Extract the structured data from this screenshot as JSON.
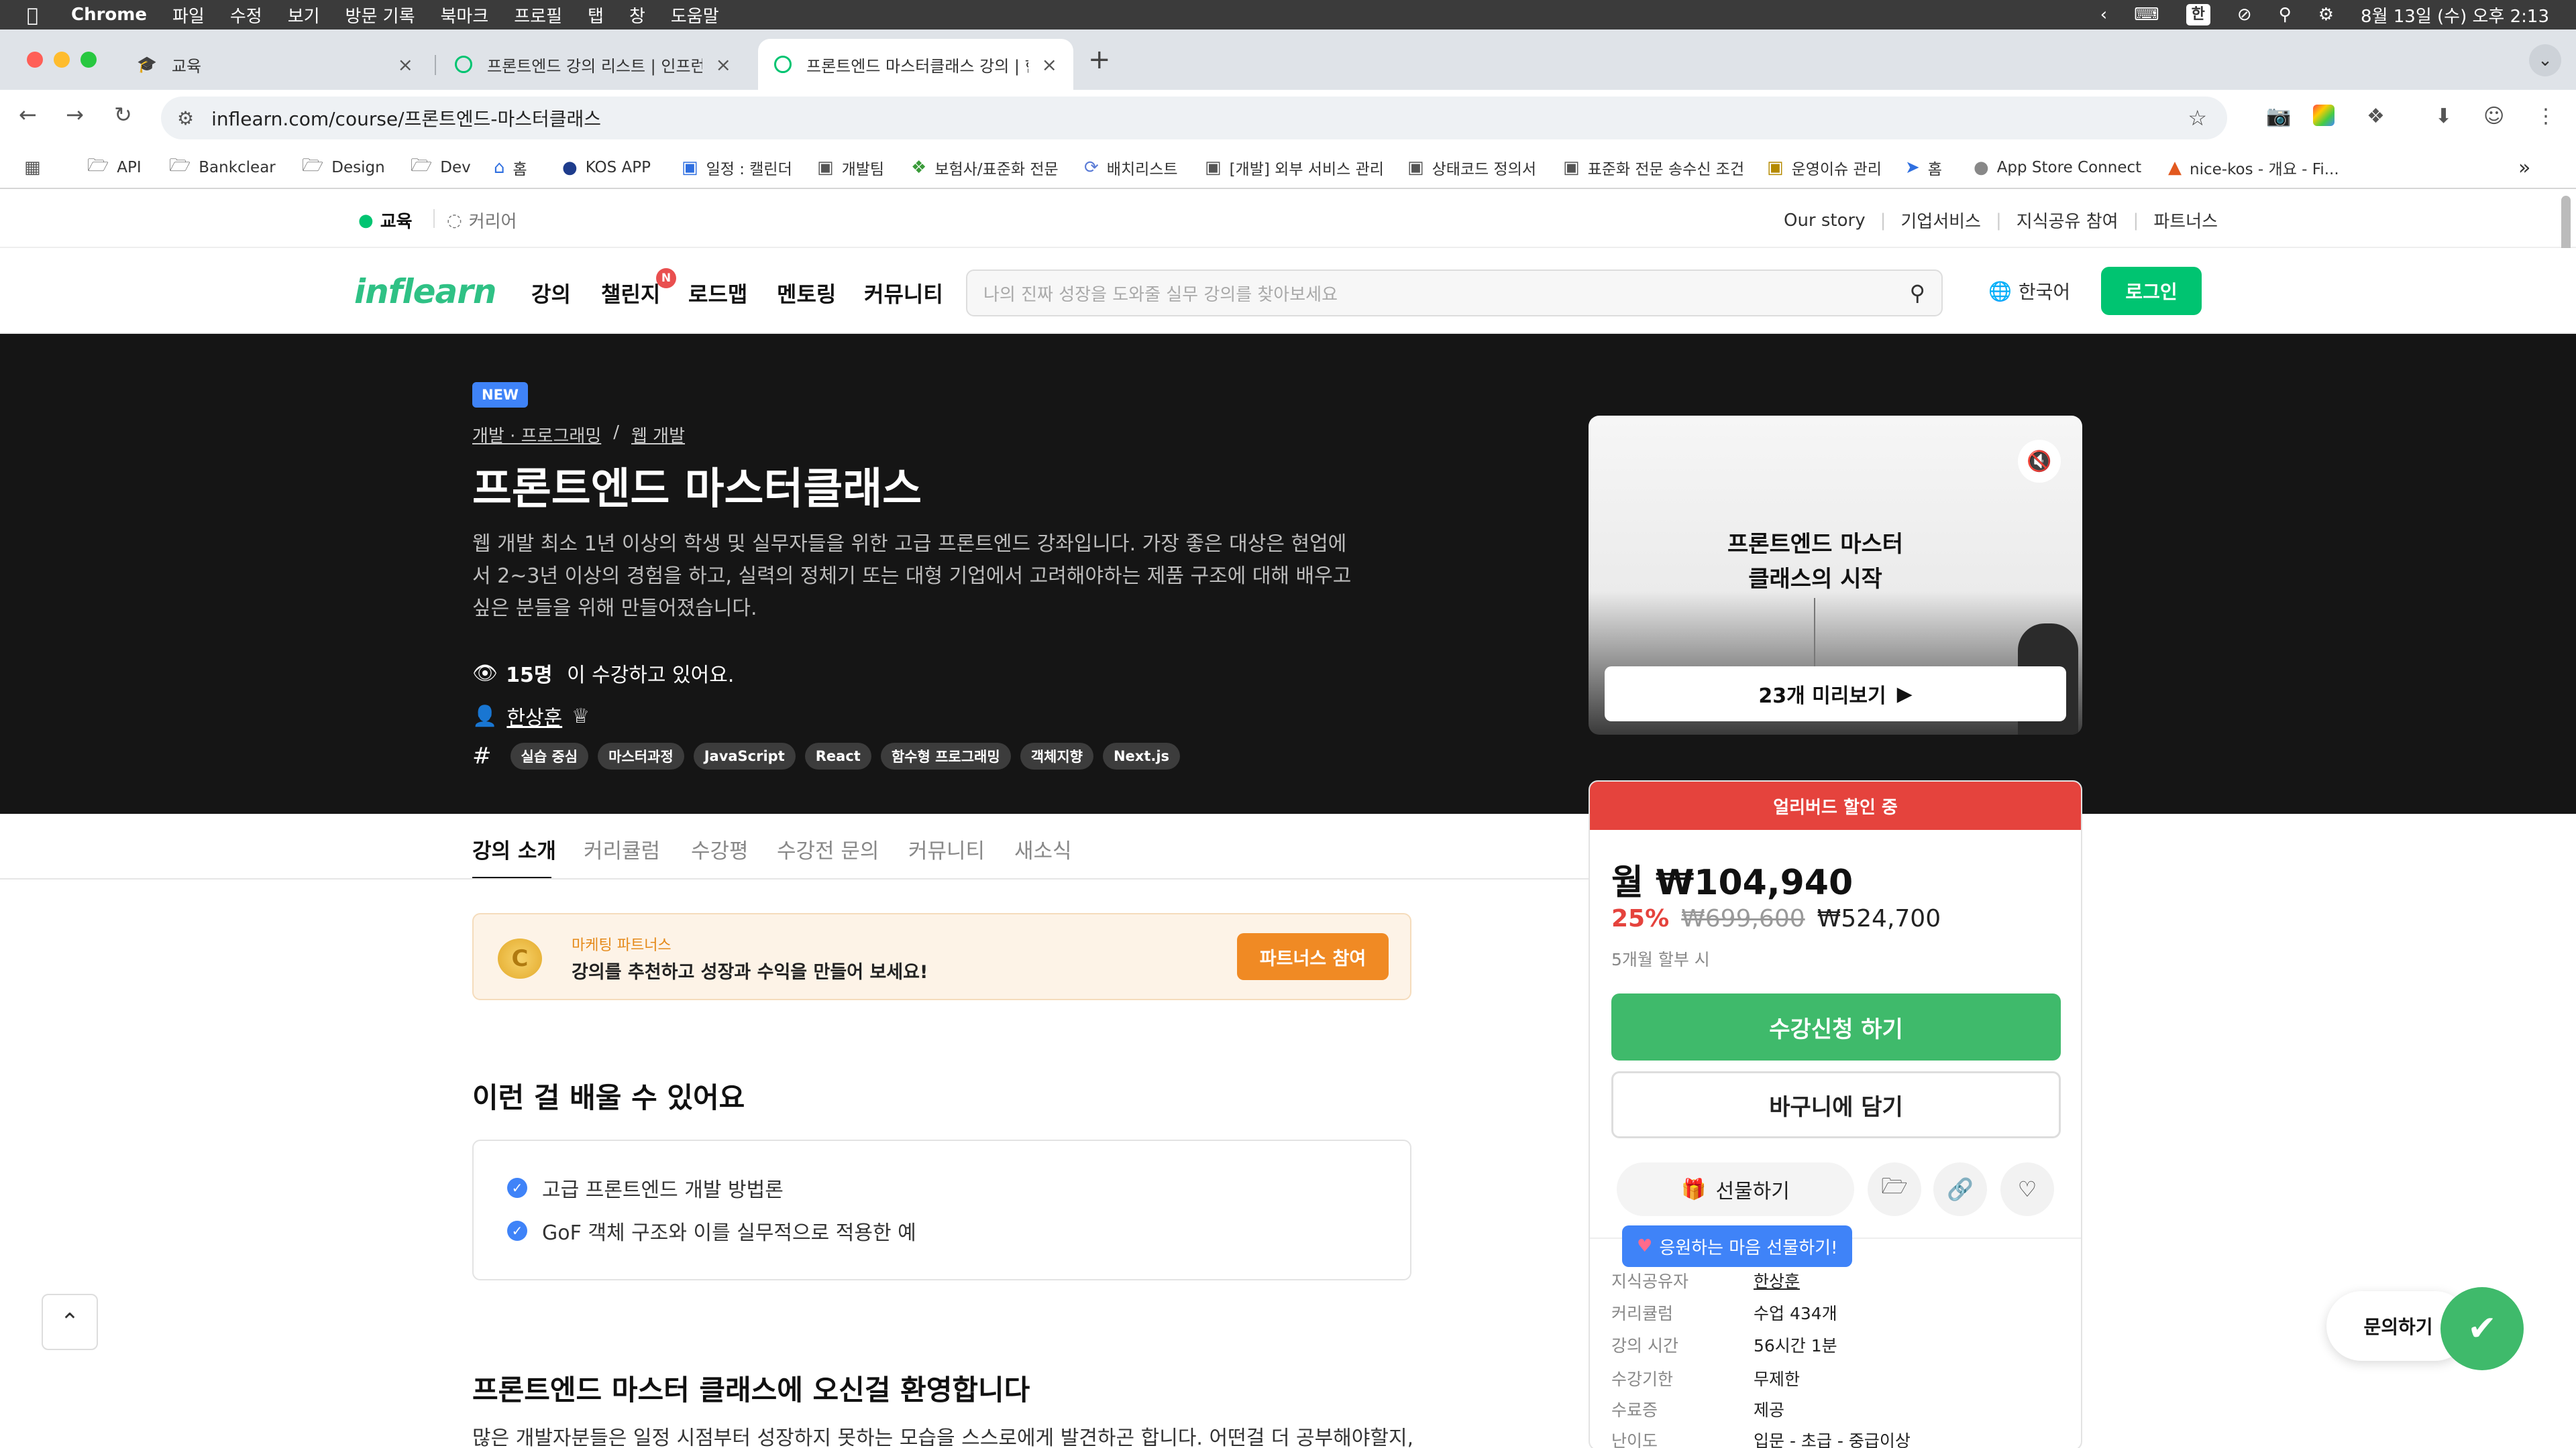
{
  "menubar": {
    "apple": "",
    "items": [
      "Chrome",
      "파일",
      "수정",
      "보기",
      "방문 기록",
      "북마크",
      "프로필",
      "탭",
      "창",
      "도움말"
    ],
    "input_source": "한",
    "datetime": "8월 13일 (수) 오후 2:13"
  },
  "tabs": [
    {
      "title": "교육"
    },
    {
      "title": "프론트엔드 강의 리스트 | 인프런"
    },
    {
      "title": "프론트엔드 마스터클래스 강의 | 한상훈"
    }
  ],
  "toolbar": {
    "url": "inflearn.com/course/프론트엔드-마스터클래스"
  },
  "bookmarks": [
    "API",
    "Bankclear",
    "Design",
    "Dev",
    "홈",
    "KOS APP",
    "일정 : 캘린더",
    "개발팀",
    "보험사/표준화 전문",
    "배치리스트",
    "[개발] 외부 서비스 관리",
    "상태코드 정의서",
    "표준화 전문 송수신 조건",
    "운영이슈 관리",
    "홈",
    "App Store Connect",
    "nice-kos - 개요 - Fi..."
  ],
  "site_top": {
    "edu": "교육",
    "career": "커리어",
    "links": [
      "Our story",
      "기업서비스",
      "지식공유 참여",
      "파트너스"
    ]
  },
  "nav": {
    "logo": "inflearn",
    "items": [
      "강의",
      "챌린지",
      "로드맵",
      "멘토링",
      "커뮤니티"
    ],
    "challenge_badge": "N",
    "search_placeholder": "나의 진짜 성장을 도와줄 실무 강의를 찾아보세요",
    "language": "한국어",
    "login": "로그인"
  },
  "course": {
    "badge": "NEW",
    "category1": "개발 · 프로그래밍",
    "separator": "/",
    "category2": "웹 개발",
    "title": "프론트엔드 마스터클래스",
    "description": "웹 개발 최소 1년 이상의 학생 및 실무자들을 위한 고급 프론트엔드 강좌입니다. 가장 좋은 대상은 현업에서 2~3년 이상의 경험을 하고, 실력의 정체기 또는 대형 기업에서 고려해야하는 제품 구조에 대해 배우고 싶은 분들을 위해 만들어졌습니다.",
    "students_count": "15명",
    "students_suffix": " 이 수강하고 있어요.",
    "instructor": "한상훈",
    "tags": [
      "실습 중심",
      "마스터과정",
      "JavaScript",
      "React",
      "함수형 프로그래밍",
      "객체지향",
      "Next.js"
    ]
  },
  "preview": {
    "video_title_line1": "프론트엔드 마스터",
    "video_title_line2": "클래스의 시작",
    "preview_button": "23개 미리보기"
  },
  "content_tabs": [
    "강의 소개",
    "커리큘럼",
    "수강평",
    "수강전 문의",
    "커뮤니티",
    "새소식"
  ],
  "partners_banner": {
    "label": "마케팅 파트너스",
    "text": "강의를 추천하고 성장과 수익을 만들어 보세요!",
    "button": "파트너스 참여"
  },
  "learn": {
    "heading": "이런 걸 배울 수 있어요",
    "items": [
      "고급 프론트엔드 개발 방법론",
      "GoF 객체 구조와 이를 실무적으로 적용한 예"
    ]
  },
  "welcome": {
    "heading": "프론트엔드 마스터 클래스에 오신걸 환영합니다",
    "text": "많은 개발자분들은 일정 시점부터 성장하지 못하는 모습을 스스로에게 발견하곤 합니다. 어떤걸 더 공부해야할지,"
  },
  "pricing": {
    "banner": "얼리버드 할인 중",
    "monthly": "월 ₩104,940",
    "discount": "25%",
    "original": "₩699,600",
    "final": "₩524,700",
    "installment": "5개월 할부 시",
    "enroll": "수강신청 하기",
    "cart": "바구니에 담기",
    "gift": "선물하기",
    "gift_tooltip": "응원하는 마음 선물하기!",
    "info": [
      {
        "k": "지식공유자",
        "v": "한상훈"
      },
      {
        "k": "커리큘럼",
        "v": "수업 434개"
      },
      {
        "k": "강의 시간",
        "v": "56시간 1분"
      },
      {
        "k": "수강기한",
        "v": "무제한"
      },
      {
        "k": "수료증",
        "v": "제공"
      },
      {
        "k": "난이도",
        "v": "입문 - 초급 - 중급이상"
      }
    ]
  },
  "floating": {
    "inquiry": "문의하기"
  },
  "colors": {
    "brand": "#00c471",
    "enroll": "#3fba6b",
    "early_bird": "#e5433d",
    "tag_new": "#3f83f8"
  }
}
